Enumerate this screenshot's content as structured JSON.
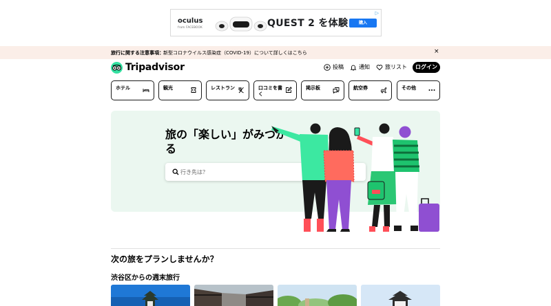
{
  "ad": {
    "brand": "oculus",
    "brand_sub": "from FACEBOOK",
    "headline": "QUEST 2 を体験",
    "cta": "購入",
    "adchoices": "▷"
  },
  "notice": {
    "title": "旅行に関する注意事項：",
    "link": "新型コロナウイルス感染症（COVID-19）について詳しくはこちら",
    "close": "×"
  },
  "header": {
    "logo": "Tripadvisor",
    "post": "投稿",
    "alerts": "通知",
    "trips": "旅リスト",
    "login": "ログイン"
  },
  "categories": [
    {
      "label": "ホテル",
      "icon": "bed-icon"
    },
    {
      "label": "観光",
      "icon": "ticket-icon"
    },
    {
      "label": "レストラン",
      "icon": "utensils-icon"
    },
    {
      "label": "口コミを書く",
      "icon": "edit-icon"
    },
    {
      "label": "掲示板",
      "icon": "chat-icon"
    },
    {
      "label": "航空券",
      "icon": "plane-icon"
    },
    {
      "label": "その他",
      "icon": "more-icon"
    }
  ],
  "hero": {
    "title": "旅の「楽しい」がみつかる",
    "search_placeholder": "行き先は？"
  },
  "sections": {
    "plan_title": "次の旅をプランしませんか？",
    "weekend_title": "渋谷区からの週末旅行"
  },
  "colors": {
    "brand_green": "#34e0a1",
    "hero_bg": "#ebf7f0",
    "notice_bg": "#fbeee8",
    "ad_button": "#1877f2"
  }
}
